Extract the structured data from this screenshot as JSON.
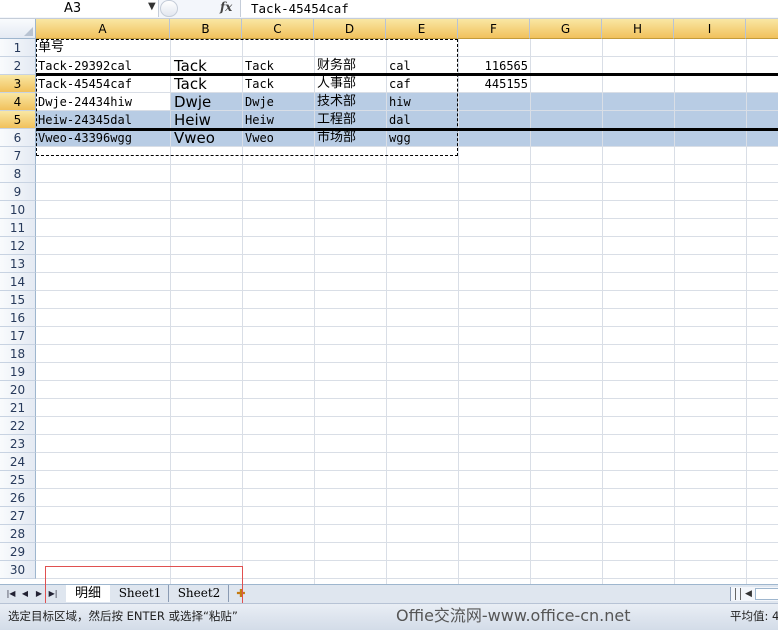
{
  "formula_bar": {
    "name_box": "A3",
    "fx_label": "fx",
    "formula": "Tack-45454caf"
  },
  "columns": [
    "A",
    "B",
    "C",
    "D",
    "E",
    "F",
    "G",
    "H",
    "I"
  ],
  "rows": [
    "1",
    "2",
    "3",
    "4",
    "5",
    "6",
    "7",
    "8",
    "9",
    "10",
    "11",
    "12",
    "13",
    "14",
    "15",
    "16",
    "17",
    "18",
    "19",
    "20",
    "21",
    "22",
    "23",
    "24",
    "25",
    "26",
    "27",
    "28",
    "29",
    "30"
  ],
  "cells": {
    "A1": "单号",
    "A2": "Tack-29392cal",
    "B2": "Tack",
    "C2": "Tack",
    "D2": "财务部",
    "E2": "cal",
    "F2": "116565",
    "A3": "Tack-45454caf",
    "B3": "Tack",
    "C3": "Tack",
    "D3": "人事部",
    "E3": "caf",
    "F3": "445155",
    "A4": "Dwje-24434hiw",
    "B4": "Dwje",
    "C4": "Dwje",
    "D4": "技术部",
    "E4": "hiw",
    "A5": "Heiw-24345dal",
    "B5": "Heiw",
    "C5": "Heiw",
    "D5": "工程部",
    "E5": "dal",
    "A6": "Vweo-43396wgg",
    "B6": "Vweo",
    "C6": "Vweo",
    "D6": "市场部",
    "E6": "wgg"
  },
  "sheet_tabs": {
    "active": "明细",
    "sheet1": "Sheet1",
    "sheet2": "Sheet2"
  },
  "status_bar": {
    "message": "选定目标区域，然后按 ENTER 或选择“粘贴”",
    "watermark": "Offie交流网-www.office-cn.net",
    "average": "平均值: 4"
  }
}
